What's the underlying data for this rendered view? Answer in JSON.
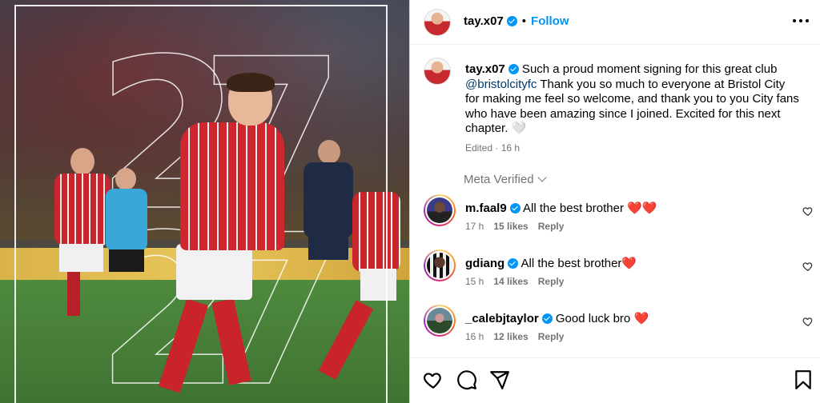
{
  "post": {
    "author": "tay.x07",
    "follow_label": "Follow",
    "dot": "•",
    "caption": {
      "author": "tay.x07",
      "text_before": " Such a proud moment signing for this great club ",
      "mention": "@bristolcityfc",
      "text_after": " Thank you so much to everyone at Bristol City for making me feel so welcome, and thank you to you City fans who have been amazing since I joined. Excited for this next chapter. ",
      "heart": "🤍",
      "meta": "Edited · 16 h"
    },
    "meta_verified_label": "Meta Verified"
  },
  "comments": [
    {
      "user": "m.faal9",
      "text": "All the best brother ",
      "emoji": "❤️❤️",
      "time": "17 h",
      "likes": "15 likes",
      "reply": "Reply"
    },
    {
      "user": "gdiang",
      "text": "All the best brother",
      "emoji": "❤️",
      "time": "15 h",
      "likes": "14 likes",
      "reply": "Reply"
    },
    {
      "user": "_calebjtaylor",
      "text": "Good luck bro ",
      "emoji": "❤️",
      "time": "16 h",
      "likes": "12 likes",
      "reply": "Reply"
    }
  ],
  "media": {
    "jersey_number": "27",
    "digit_1": "2",
    "digit_2": "7"
  },
  "icons": {
    "like": "heart-icon",
    "comment": "comment-icon",
    "share": "share-icon",
    "save": "bookmark-icon",
    "more": "more-icon"
  },
  "colors": {
    "accent": "#0095f6",
    "mention": "#00376b",
    "muted": "#737373"
  }
}
